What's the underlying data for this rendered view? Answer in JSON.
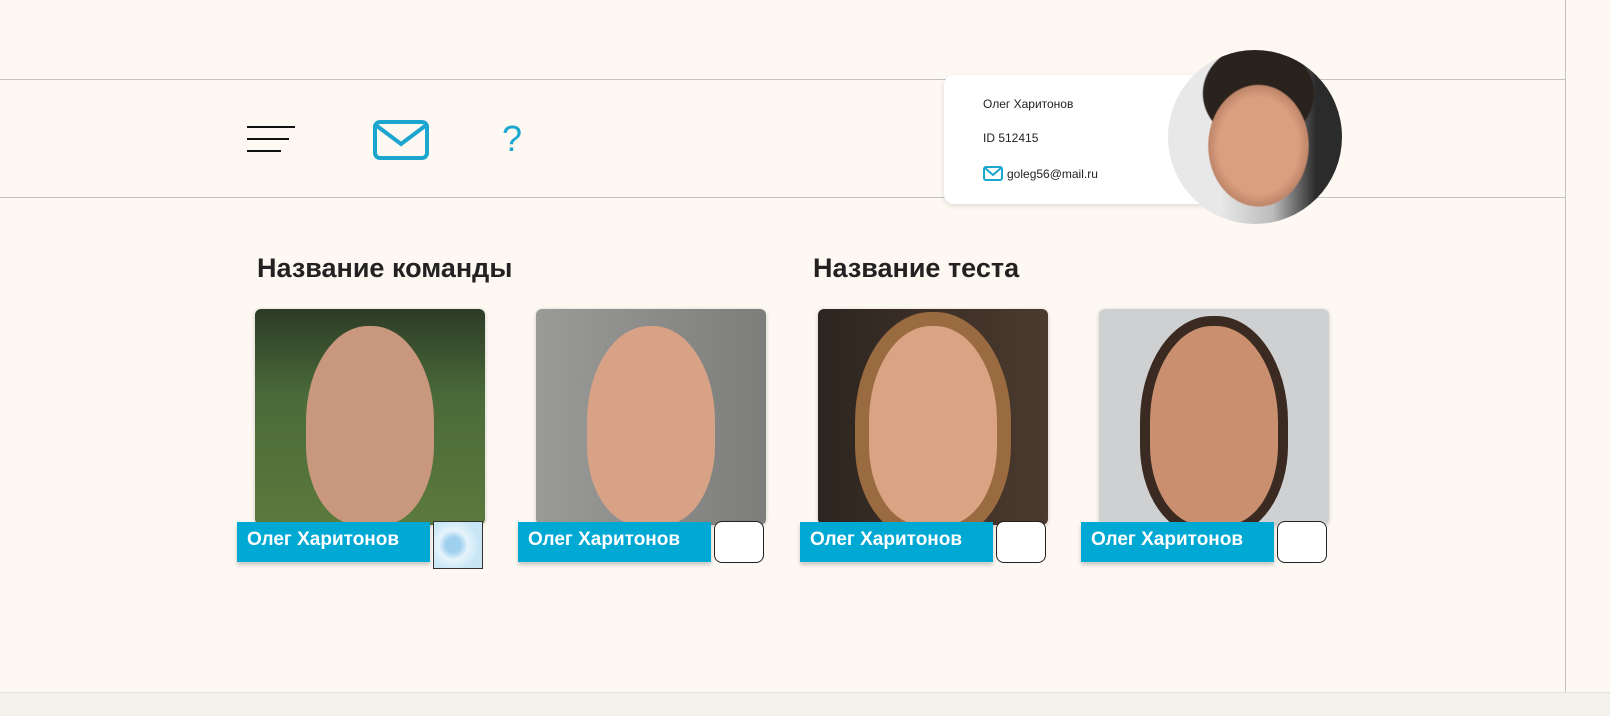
{
  "header": {
    "menu_icon": "hamburger-icon",
    "mail_icon": "envelope-icon",
    "help_label": "?",
    "accent_color": "#00a8d4"
  },
  "profile": {
    "name": "Олег Харитонов",
    "id": "ID 512415",
    "email": "goleg56@mail.ru"
  },
  "sections": {
    "team_title": "Название команды",
    "test_title": "Название теста"
  },
  "members": [
    {
      "name": "Олег Харитонов"
    },
    {
      "name": "Олег Харитонов"
    },
    {
      "name": "Олег Харитонов"
    },
    {
      "name": "Олег Харитонов"
    }
  ]
}
